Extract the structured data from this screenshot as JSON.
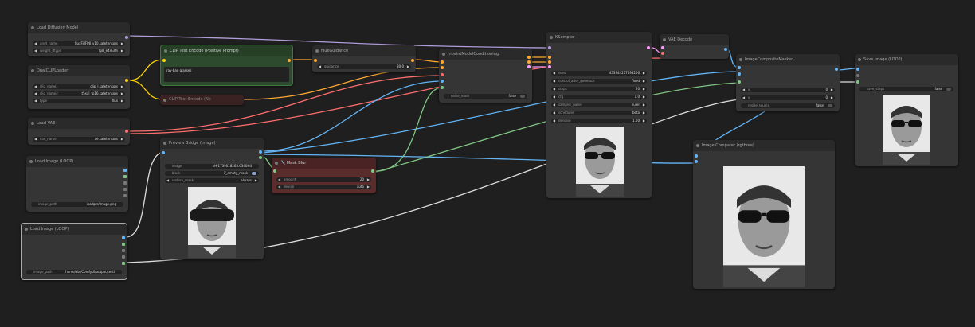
{
  "nodes": {
    "load_diffusion": {
      "title": "Load Diffusion Model",
      "unet_name_label": "unet_name",
      "unet_name_value": "fluxFillFP8_v10.safetensors",
      "weight_dtype_label": "weight_dtype",
      "weight_dtype_value": "fp8_e4m3fn"
    },
    "dual_clip": {
      "title": "DualCLIPLoader",
      "clip1_label": "clip_name1",
      "clip1_value": "clip_l.safetensors",
      "clip2_label": "clip_name2",
      "clip2_value": "t5xxl_fp16.safetensors",
      "type_label": "type",
      "type_value": "flux"
    },
    "load_vae": {
      "title": "Load VAE",
      "vae_label": "vae_name",
      "vae_value": "ae.safetensors"
    },
    "clip_pos": {
      "title": "CLIP Text Encode (Positive Prompt)",
      "text": "ray-ban glasses"
    },
    "clip_neg": {
      "title": "CLIP Text Encode (Ne"
    },
    "flux_guidance": {
      "title": "FluxGuidance",
      "guidance_label": "guidance",
      "guidance_value": "30.0"
    },
    "inpaint_cond": {
      "title": "InpaintModelConditioning",
      "noise_mask_label": "noise_mask",
      "noise_mask_value": "false"
    },
    "ksampler": {
      "title": "KSampler",
      "seed_label": "seed",
      "seed_value": "433944217698206",
      "control_label": "control_after_generate",
      "control_value": "fixed",
      "steps_label": "steps",
      "steps_value": "20",
      "cfg_label": "cfg",
      "cfg_value": "1.0",
      "sampler_label": "sampler_name",
      "sampler_value": "euler",
      "scheduler_label": "scheduler",
      "scheduler_value": "beta",
      "denoise_label": "denoise",
      "denoise_value": "1.00"
    },
    "vae_decode": {
      "title": "VAE Decode"
    },
    "image_composite": {
      "title": "ImageCompositeMasked",
      "x_label": "x",
      "x_value": "0",
      "y_label": "y",
      "y_value": "0",
      "resize_label": "resize_source",
      "resize_value": "false"
    },
    "save_image": {
      "title": "Save Image (LOOP)",
      "save_steps_label": "save_steps",
      "save_steps_value": "false"
    },
    "load_image_1": {
      "title": "Load Image (LOOP)",
      "path_label": "image_path",
      "path_value": "ipadptr/image.png"
    },
    "load_image_2": {
      "title": "Load Image (LOOP)",
      "path_label": "image_path",
      "path_value": "/home/abi/ComfyUI/output/testi"
    },
    "preview_bridge": {
      "title": "Preview Bridge (Image)",
      "image_label": "image",
      "image_value": "$H-1739018265.6340H4",
      "block_label": "block",
      "block_value": "if_empty_mask",
      "restore_label": "restore_mask",
      "restore_value": "always"
    },
    "mask_blur": {
      "title": "🔧 Mask Blur",
      "amount_label": "amount",
      "amount_value": "20",
      "device_label": "device",
      "device_value": "auto"
    },
    "image_comparer": {
      "title": "Image Comparer (rgthree)"
    }
  },
  "colors": {
    "model": "#b39ddb",
    "clip": "#ffd500",
    "vae": "#ff6e6e",
    "image": "#64b5f6",
    "mask": "#81c784",
    "latent": "#ff9cf9",
    "cond": "#ffa931",
    "wire_white": "#dddddd"
  }
}
